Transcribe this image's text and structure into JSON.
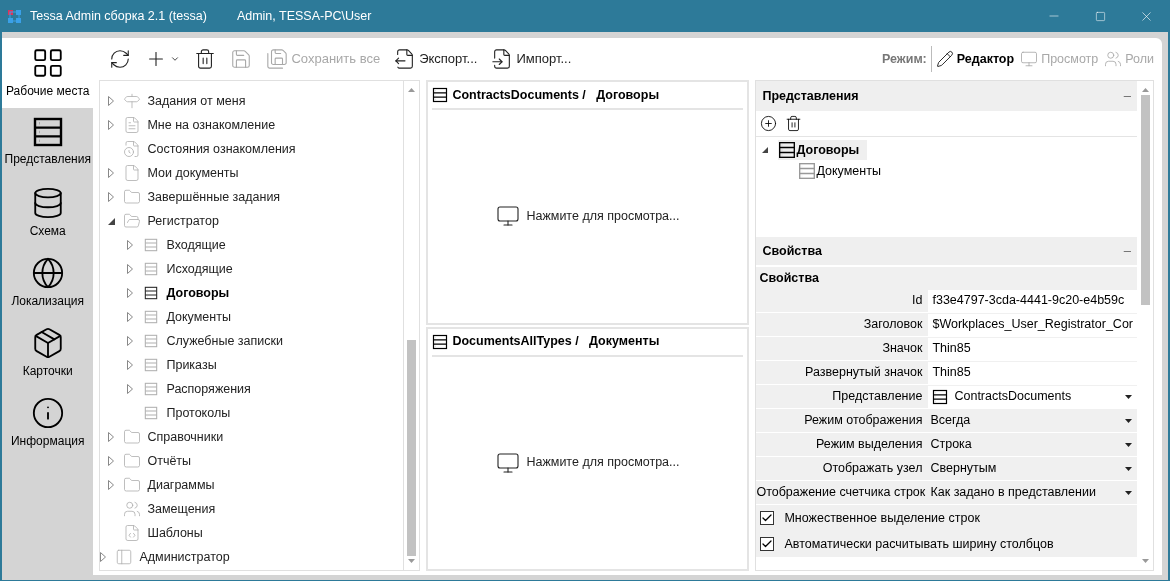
{
  "window": {
    "title": "Tessa Admin сборка 2.1 (tessa)",
    "user": "Admin, TESSA-PC\\User"
  },
  "nav": [
    {
      "label": "Рабочие места",
      "kind": "workplaces",
      "selected": true
    },
    {
      "label": "Представления",
      "kind": "views",
      "selected": false
    },
    {
      "label": "Схема",
      "kind": "schema",
      "selected": false
    },
    {
      "label": "Локализация",
      "kind": "localization",
      "selected": false
    },
    {
      "label": "Карточки",
      "kind": "cards",
      "selected": false
    },
    {
      "label": "Информация",
      "kind": "info",
      "selected": false
    }
  ],
  "toolbar": {
    "buttons": [
      {
        "kind": "refresh",
        "disabled": false
      },
      {
        "kind": "add",
        "disabled": false
      },
      {
        "kind": "delete",
        "disabled": false
      },
      {
        "kind": "save",
        "disabled": true
      },
      {
        "kind": "save-all",
        "label": "Сохранить все",
        "disabled": true
      },
      {
        "kind": "export",
        "label": "Экспорт...",
        "disabled": false
      },
      {
        "kind": "import",
        "label": "Импорт...",
        "disabled": false
      }
    ],
    "mode_label": "Режим:",
    "modes": [
      {
        "kind": "editor",
        "label": "Редактор",
        "selected": true
      },
      {
        "kind": "preview",
        "label": "Просмотр",
        "selected": false
      },
      {
        "kind": "roles",
        "label": "Роли",
        "selected": false
      }
    ]
  },
  "tree": {
    "items": [
      {
        "children": [
          {
            "label": "Задания от меня",
            "kind": "flag",
            "expanded": false,
            "selected": false
          },
          {
            "label": "Мне на ознакомление",
            "kind": "review",
            "expanded": false,
            "selected": false
          },
          {
            "label": "Состояния ознакомления",
            "kind": "review-state",
            "selected": false
          },
          {
            "label": "Мои документы",
            "kind": "document",
            "expanded": false,
            "selected": false
          },
          {
            "label": "Завершённые задания",
            "kind": "folder",
            "expanded": false,
            "selected": false
          },
          {
            "label": "Регистратор",
            "kind": "folder-open",
            "expanded": true,
            "selected": false,
            "children": [
              {
                "label": "Входящие",
                "kind": "view",
                "expanded": false,
                "selected": false
              },
              {
                "label": "Исходящие",
                "kind": "view",
                "expanded": false,
                "selected": false
              },
              {
                "label": "Договоры",
                "kind": "view",
                "expanded": false,
                "selected": true
              },
              {
                "label": "Документы",
                "kind": "view",
                "expanded": false,
                "selected": false
              },
              {
                "label": "Служебные записки",
                "kind": "view",
                "expanded": false,
                "selected": false
              },
              {
                "label": "Приказы",
                "kind": "view",
                "expanded": false,
                "selected": false
              },
              {
                "label": "Распоряжения",
                "kind": "view",
                "expanded": false,
                "selected": false
              },
              {
                "label": "Протоколы",
                "kind": "view",
                "selected": false
              }
            ]
          },
          {
            "label": "Справочники",
            "kind": "folder",
            "expanded": false,
            "selected": false
          },
          {
            "label": "Отчёты",
            "kind": "folder",
            "expanded": false,
            "selected": false
          },
          {
            "label": "Диаграммы",
            "kind": "folder",
            "expanded": false,
            "selected": false
          },
          {
            "label": "Замещения",
            "kind": "substitution",
            "selected": false
          },
          {
            "label": "Шаблоны",
            "kind": "template",
            "selected": false
          }
        ]
      },
      {
        "label": "Администратор",
        "kind": "admin",
        "expanded": false,
        "selected": false
      }
    ]
  },
  "previews": [
    {
      "heading": "ContractsDocuments /   Договоры",
      "hint": "Нажмите для просмотра..."
    },
    {
      "heading": "DocumentsAllTypes /   Документы",
      "hint": "Нажмите для просмотра..."
    }
  ],
  "views_section": {
    "title": "Представления",
    "collapse": "–",
    "items": [
      {
        "label": "Договоры",
        "selected": true,
        "expanded": true,
        "children": [
          {
            "label": "Документы",
            "selected": false
          }
        ]
      }
    ]
  },
  "properties_section": {
    "title": "Свойства",
    "collapse": "–",
    "group": "Свойства",
    "rows": [
      {
        "label": "Id",
        "value": "f33e4797-3cda-4441-9c20-e4b59c",
        "kind": "text"
      },
      {
        "label": "Заголовок",
        "value": "$Workplaces_User_Registrator_Cor",
        "kind": "text"
      },
      {
        "label": "Значок",
        "value": "Thin85",
        "kind": "text"
      },
      {
        "label": "Развернутый значок",
        "value": "Thin85",
        "kind": "text"
      },
      {
        "label": "Представление",
        "value": "ContractsDocuments",
        "kind": "view-select"
      },
      {
        "label": "Режим отображения",
        "value": "Всегда",
        "kind": "select"
      },
      {
        "label": "Режим выделения",
        "value": "Строка",
        "kind": "select"
      },
      {
        "label": "Отображать узел",
        "value": "Свернутым",
        "kind": "select"
      },
      {
        "label": "Отображение счетчика строк",
        "value": "Как задано в представлении",
        "kind": "select"
      }
    ],
    "checkboxes": [
      {
        "label": "Множественное выделение строк",
        "checked": true
      },
      {
        "label": "Автоматически расчитывать ширину столбцов",
        "checked": true
      }
    ]
  }
}
